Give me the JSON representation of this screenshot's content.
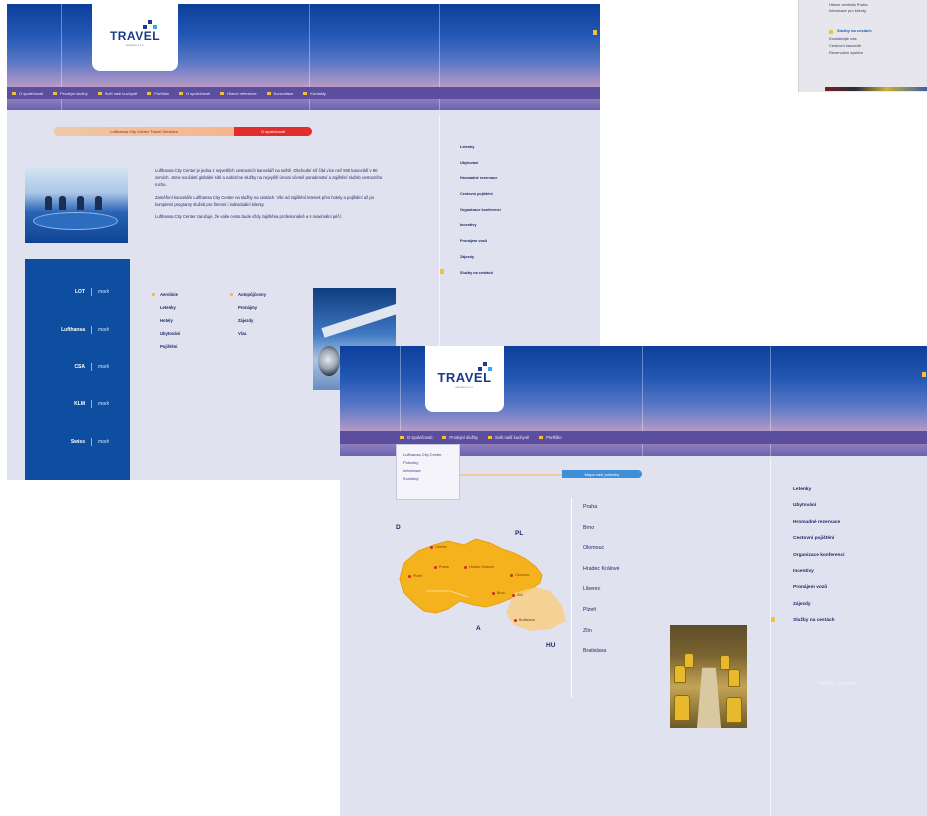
{
  "site": {
    "logo_text": "TRAVEL",
    "logo_sub": "services s.r.o.",
    "colors": {
      "accent": "#f2c03c",
      "brand": "#1b3a8c",
      "nav": "#5c4e9e",
      "partners": "#0d4ea1",
      "red": "#e32d2d"
    }
  },
  "win1": {
    "nav": [
      "O společnosti",
      "Prodejní služby",
      "Svět naší kuchyně",
      "Portfólio",
      "O společnosti",
      "Hlavní reference",
      "Konzultace",
      "Kontakty"
    ],
    "pill_left": "Lufthansa City Center Travel Services",
    "pill_right": "O společnosti",
    "paragraphs": [
      "Lufthansa City Center je jedna z nejvetších cestovních kanceláří na světě. Obchodní síť čítá více než 500 kanceláří v 80 zemích. Jsme součástí globální sítě a nabízíme služby na nejvyšší úrovni včetně poradenství a zajištění služeb cestovního ruchu.",
      "Zaměření kanceláře Lufthansa City Center na služby na cestách. Vše od zajištění letenek přes hotely a pojištění až po kompletní programy služeb pro firemní i individuální klienty.",
      "Lufthansa City Center zaručuje, že vaše cesta bude vždy zajištěna profesionálně a s maximální péčí."
    ],
    "partners": [
      "LOT",
      "Lufthansa",
      "CSA",
      "KLM",
      "Swiss"
    ],
    "partner_mark": "mark",
    "dests_col1": [
      "Aerolinie",
      "Letenky",
      "Hotely",
      "Ubytování",
      "Pojištění"
    ],
    "dests_col2": [
      "Autopůjčovny",
      "Pronájmy",
      "Zájezdy",
      "Víza"
    ],
    "side_links": [
      "Letenky",
      "Ubytování",
      "Hromadné rezervace",
      "Cestovní pojištění",
      "Organizace konferencí",
      "Incentivy",
      "Pronájem vozů",
      "Zájezdy",
      "Služby na cestách"
    ]
  },
  "win2": {
    "nav": [
      "O společnosti",
      "Prodejní služby",
      "Svět naší kuchyně",
      "Portfólio"
    ],
    "dropdown": [
      "Lufthansa City Center",
      "Pobočky",
      "Informace",
      "Kontakty"
    ],
    "tab": "Mapa naší pobočky",
    "map_labels": {
      "d": "D",
      "pl": "PL",
      "a": "A",
      "hu": "HU"
    },
    "cities": [
      "Liberec",
      "Praha",
      "Plzeň",
      "Hradec Králové",
      "Olomouc",
      "Brno",
      "Zlín",
      "Bratislava"
    ],
    "dest_list": [
      "Praha",
      "Brno",
      "Olomouc",
      "Hradec Králové",
      "Liberec",
      "Plzeň",
      "Zlín",
      "Bratislava"
    ],
    "side_links": [
      "Letenky",
      "Ubytování",
      "Hromadné rezervace",
      "Cestovní pojištění",
      "Organizace konferencí",
      "Incentivy",
      "Pronájem vozů",
      "Zájezdy",
      "Služby na cestách"
    ],
    "watermark": "TRAVEL services"
  },
  "win3": {
    "lines": [
      "Hlavní centrála Praha",
      "Informace pro klienty",
      "Služby na cestách",
      "Kontaktujte nás",
      "Cestovní kancelář",
      "Rezervační systém"
    ]
  }
}
